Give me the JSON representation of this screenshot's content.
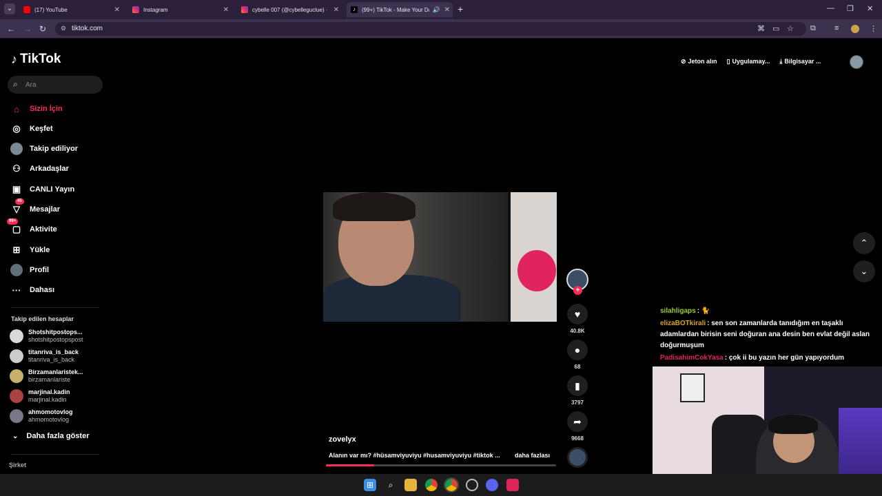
{
  "browser": {
    "tabs": [
      {
        "title": "(17) YouTube"
      },
      {
        "title": "Instagram"
      },
      {
        "title": "cybelle 007 (@cybelleguclue) ·"
      },
      {
        "title": "(99+) TikTok - Make Your Da"
      }
    ],
    "url": "tiktok.com"
  },
  "sidebar": {
    "logo": "TikTok",
    "search_placeholder": "Ara",
    "nav": [
      {
        "label": "Sizin İçin",
        "icon": "home-icon",
        "active": true
      },
      {
        "label": "Keşfet",
        "icon": "compass-icon"
      },
      {
        "label": "Takip ediliyor",
        "icon": "avatar"
      },
      {
        "label": "Arkadaşlar",
        "icon": "friends-icon"
      },
      {
        "label": "CANLI Yayın",
        "icon": "live-icon"
      },
      {
        "label": "Mesajlar",
        "icon": "send-icon",
        "badge": "45"
      },
      {
        "label": "Aktivite",
        "icon": "inbox-icon",
        "badge": "99+"
      },
      {
        "label": "Yükle",
        "icon": "upload-icon"
      },
      {
        "label": "Profil",
        "icon": "avatar"
      },
      {
        "label": "Dahası",
        "icon": "more-icon"
      }
    ],
    "following_header": "Takip edilen hesaplar",
    "accounts": [
      {
        "name": "Shotshitpostops...",
        "handle": "shotshitpostopspost"
      },
      {
        "name": "titanriva_is_back",
        "handle": "titanriva_is_back"
      },
      {
        "name": "Birzamanlaristek...",
        "handle": "birzamanlariste"
      },
      {
        "name": "marjinal.kadin",
        "handle": "marjinal.kadin"
      },
      {
        "name": "ahmomotovlog",
        "handle": "ahmomotovlog"
      }
    ],
    "show_more": "Daha fazla göster",
    "company": "Şirket"
  },
  "top_actions": {
    "coins": "Jeton alın",
    "app": "Uygulamay...",
    "desktop": "Bilgisayar ..."
  },
  "video": {
    "author": "zovelyx",
    "caption": "Alanın var mı? #hüsamviyuviyu #husamviyuviyu #tiktok ...",
    "more_label": "daha fazlası",
    "likes": "40.8K",
    "comments": "68",
    "saves": "3797",
    "shares": "9668",
    "progress_fraction": 0.21
  },
  "chat": [
    {
      "user": "silahligaps",
      "user_color": "#9acd32",
      "msg": ": 🐈"
    },
    {
      "user": "elizaBOTkirali",
      "user_color": "#daa520",
      "msg": ": sen son zamanlarda tanıdığım en taşaklı adamlardan birisin seni doğuran ana desin ben evlat değil aslan doğurmuşum"
    },
    {
      "user": "PadisahimCokYasa",
      "user_color": "#e0245e",
      "msg": ": çok ii bu yazın her gün yapıyordum"
    }
  ],
  "colors": {
    "accent": "#fe2c55",
    "chrome": "#2b1f3a"
  }
}
